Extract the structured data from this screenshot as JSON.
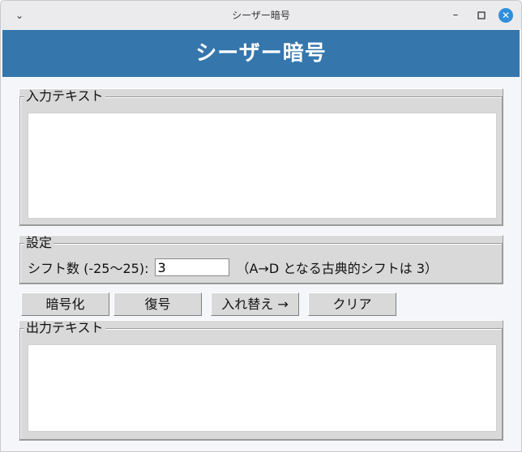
{
  "window": {
    "title": "シーザー暗号",
    "menu_icon": "chevron-down-icon",
    "minimize_icon": "minimize-icon",
    "maximize_icon": "maximize-icon",
    "close_icon": "close-icon",
    "accent_close": "#2f8fdc"
  },
  "banner": {
    "title": "シーザー暗号",
    "background": "#3576ad"
  },
  "input_section": {
    "label": "入力テキスト",
    "value": ""
  },
  "settings": {
    "label": "設定",
    "shift_label": "シフト数 (-25〜25):",
    "shift_value": "3",
    "hint": "（A→D となる古典的シフトは 3）"
  },
  "buttons": {
    "encrypt": "暗号化",
    "decrypt": "復号",
    "swap": "入れ替え →",
    "clear": "クリア"
  },
  "output_section": {
    "label": "出力テキスト",
    "value": ""
  }
}
